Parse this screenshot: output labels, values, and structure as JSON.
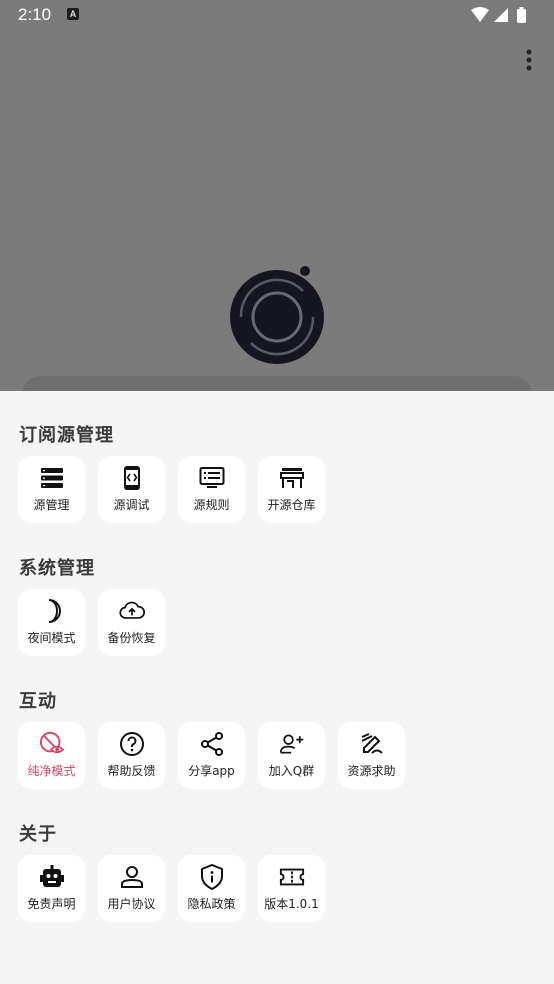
{
  "status_bar": {
    "time": "2:10",
    "notification_badge": "A",
    "icons": [
      "wifi-icon",
      "signal-icon",
      "battery-icon"
    ]
  },
  "colors": {
    "scrim": "#7b7b7b",
    "sheet_bg": "#f5f5f5",
    "tile_bg": "#ffffff",
    "accent_danger": "#d64561"
  },
  "sections": [
    {
      "title": "订阅源管理",
      "items": [
        {
          "label": "源管理",
          "icon": "server-list-icon"
        },
        {
          "label": "源调试",
          "icon": "phone-code-icon"
        },
        {
          "label": "源规则",
          "icon": "rules-list-icon"
        },
        {
          "label": "开源仓库",
          "icon": "store-icon"
        }
      ]
    },
    {
      "title": "系统管理",
      "items": [
        {
          "label": "夜间模式",
          "icon": "moon-icon"
        },
        {
          "label": "备份恢复",
          "icon": "cloud-upload-icon"
        }
      ]
    },
    {
      "title": "互动",
      "items": [
        {
          "label": "纯净模式",
          "icon": "pure-mode-icon",
          "active": true
        },
        {
          "label": "帮助反馈",
          "icon": "help-icon"
        },
        {
          "label": "分享app",
          "icon": "share-icon"
        },
        {
          "label": "加入Q群",
          "icon": "add-user-icon"
        },
        {
          "label": "资源求助",
          "icon": "edit-icon"
        }
      ]
    },
    {
      "title": "关于",
      "items": [
        {
          "label": "免责声明",
          "icon": "robot-icon"
        },
        {
          "label": "用户协议",
          "icon": "user-icon"
        },
        {
          "label": "隐私政策",
          "icon": "shield-info-icon"
        },
        {
          "label": "版本1.0.1",
          "icon": "ticket-icon"
        }
      ]
    }
  ]
}
